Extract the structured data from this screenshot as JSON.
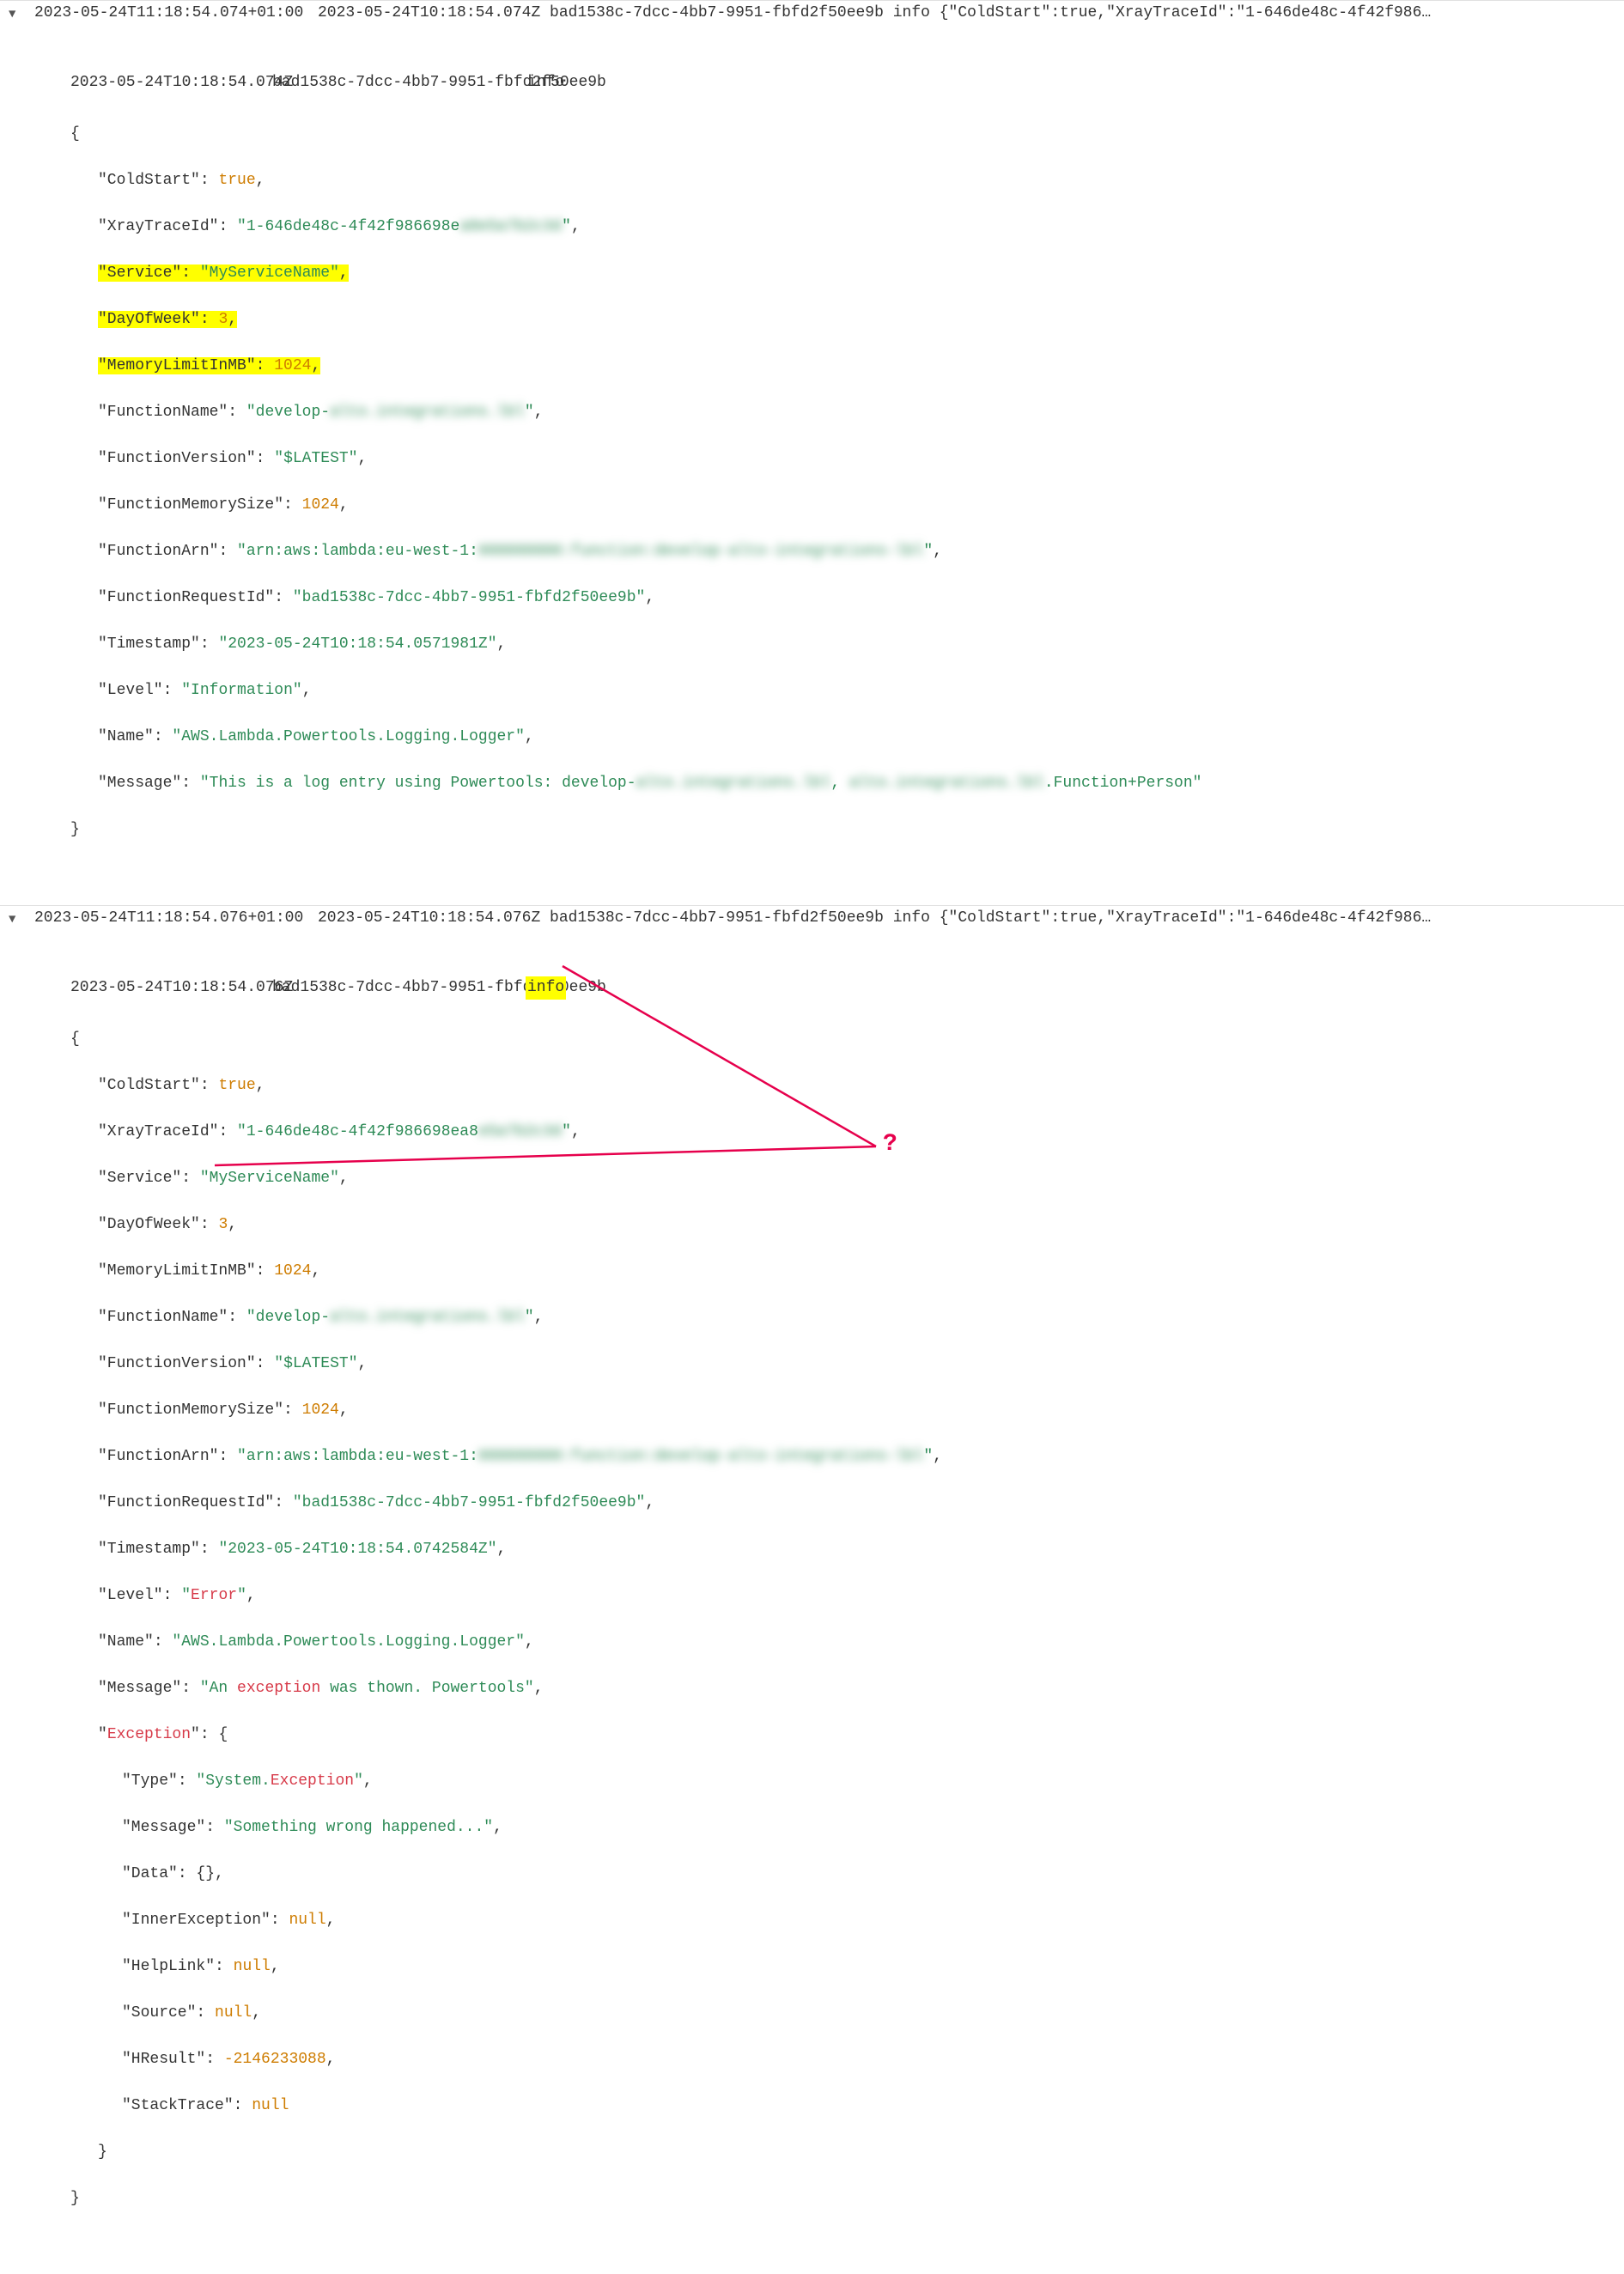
{
  "entries": [
    {
      "local_timestamp": "2023-05-24T11:18:54.074+01:00",
      "summary": "2023-05-24T10:18:54.074Z bad1538c-7dcc-4bb7-9951-fbfd2f50ee9b info {\"ColdStart\":true,\"XrayTraceId\":\"1-646de48c-4f42f986…",
      "body_timestamp": "2023-05-24T10:18:54.074Z",
      "body_request_id": "bad1538c-7dcc-4bb7-9951-fbfd2f50ee9b",
      "body_level": "info",
      "fields": {
        "ColdStart": "true",
        "XrayTraceId": "1-646de48c-4f42f986698e",
        "XrayTraceIdBlur": "a8e5a7b2c3d",
        "Service": "MyServiceName",
        "DayOfWeek": "3",
        "MemoryLimitInMB": "1024",
        "FunctionNamePrefix": "develop-",
        "FunctionNameBlur": "alto.integrations.lbl",
        "FunctionVersion": "$LATEST",
        "FunctionMemorySize": "1024",
        "FunctionArnPrefix": "arn:aws:lambda:eu-west-1:",
        "FunctionArnBlur": "000000000:function:develop-alto-integrations-lbl",
        "FunctionRequestId": "bad1538c-7dcc-4bb7-9951-fbfd2f50ee9b",
        "Timestamp": "2023-05-24T10:18:54.0571981Z",
        "Level": "Information",
        "Name": "AWS.Lambda.Powertools.Logging.Logger",
        "MessagePrefix": "This is a log entry using Powertools: develop-",
        "MessageBlur1": "alto.integrations.lbl",
        "MessageMid": ", ",
        "MessageBlur2": "alto.integrations.lbl",
        "MessageSuffix": ".Function+Person"
      }
    },
    {
      "local_timestamp": "2023-05-24T11:18:54.076+01:00",
      "summary": "2023-05-24T10:18:54.076Z bad1538c-7dcc-4bb7-9951-fbfd2f50ee9b info {\"ColdStart\":true,\"XrayTraceId\":\"1-646de48c-4f42f986…",
      "body_timestamp": "2023-05-24T10:18:54.076Z",
      "body_request_id": "bad1538c-7dcc-4bb7-9951-fbfd2f50ee9b",
      "body_level": "info",
      "fields": {
        "ColdStart": "true",
        "XrayTraceId": "1-646de48c-4f42f986698ea8",
        "XrayTraceIdBlur": "e5a7b2c3d",
        "Service": "MyServiceName",
        "DayOfWeek": "3",
        "MemoryLimitInMB": "1024",
        "FunctionNamePrefix": "develop-",
        "FunctionNameBlur": "alto.integrations.lbl",
        "FunctionVersion": "$LATEST",
        "FunctionMemorySize": "1024",
        "FunctionArnPrefix": "arn:aws:lambda:eu-west-1:",
        "FunctionArnBlur": "000000000:function:develop-alto-integrations-lbl",
        "FunctionRequestId": "bad1538c-7dcc-4bb7-9951-fbfd2f50ee9b",
        "Timestamp": "2023-05-24T10:18:54.0742584Z",
        "Level": "Error",
        "Name": "AWS.Lambda.Powertools.Logging.Logger",
        "Message": "An exception was thown. Powertools",
        "Exception": {
          "Type": "System.Exception",
          "Message": "Something wrong happened...",
          "Data": "{}",
          "InnerException": "null",
          "HelpLink": "null",
          "Source": "null",
          "HResult": "-2146233088",
          "StackTrace": "null"
        }
      },
      "annotation_mark": "?"
    }
  ]
}
